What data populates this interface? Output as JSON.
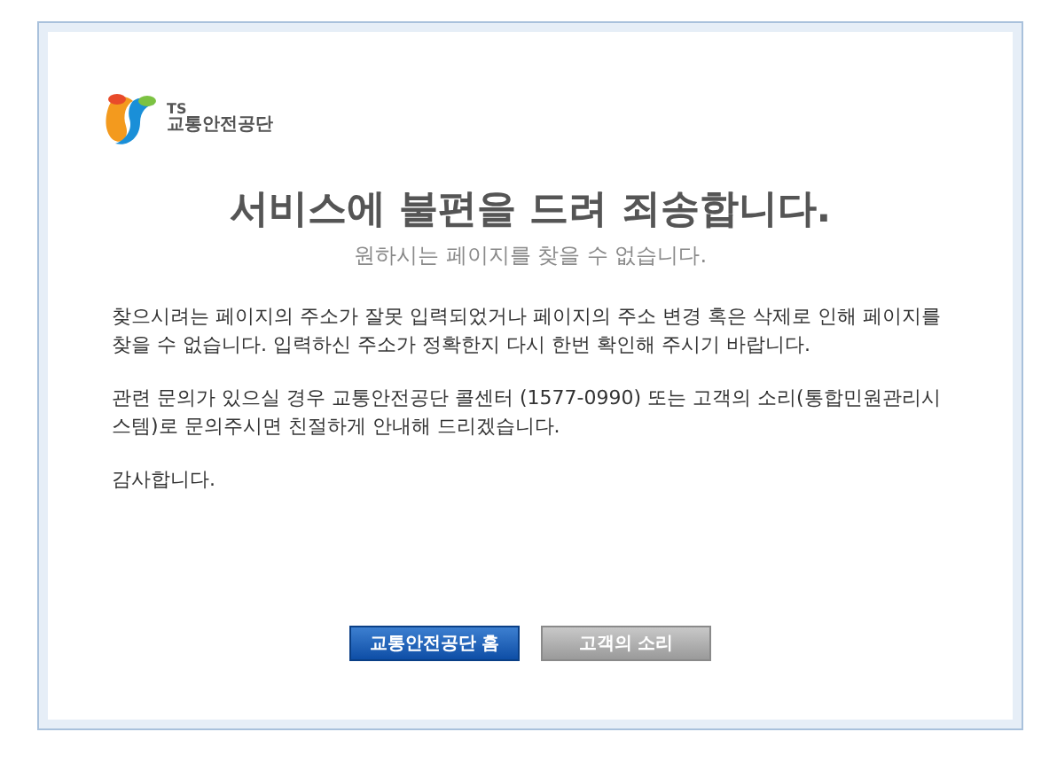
{
  "logo": {
    "abbr": "TS",
    "name": "교통안전공단"
  },
  "title": "서비스에 불편을 드려 죄송합니다.",
  "subtitle": "원하시는 페이지를 찾을 수 없습니다.",
  "paragraphs": [
    "찾으시려는 페이지의 주소가 잘못 입력되었거나 페이지의 주소 변경 혹은 삭제로 인해 페이지를 찾을 수 없습니다. 입력하신 주소가 정확한지 다시 한번 확인해 주시기 바랍니다.",
    "관련 문의가 있으실 경우 교통안전공단 콜센터 (1577-0990) 또는 고객의 소리(통합민원관리시스템)로 문의주시면 친절하게 안내해 드리겠습니다.",
    "감사합니다."
  ],
  "buttons": [
    {
      "label": "교통안전공단 홈",
      "kind": "primary"
    },
    {
      "label": "고객의 소리",
      "kind": "secondary"
    }
  ]
}
